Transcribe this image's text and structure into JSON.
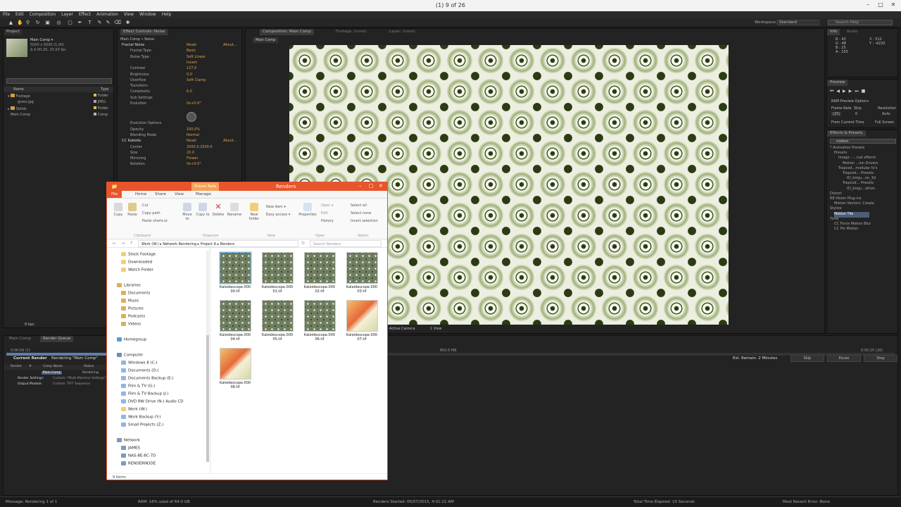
{
  "window": {
    "title": "(1) 9 of 26"
  },
  "menu": [
    "File",
    "Edit",
    "Composition",
    "Layer",
    "Effect",
    "Animation",
    "View",
    "Window",
    "Help"
  ],
  "workspace": {
    "label": "Workspace:",
    "value": "Standard"
  },
  "search_help": "Search Help",
  "project": {
    "tab": "Project",
    "comp_name": "Main Comp ▾",
    "comp_info1": "5000 x 5000 (1.00)",
    "comp_info2": "Δ 0:00:26, 25.00 fps",
    "col_name": "Name",
    "col_type": "Type",
    "items": [
      {
        "name": "Footage",
        "type": "Folder"
      },
      {
        "name": "grass.jpg",
        "type": "JPEG"
      },
      {
        "name": "Solids",
        "type": "Folder"
      },
      {
        "name": "Main Comp",
        "type": "Comp"
      }
    ],
    "bpc": "8 bpc"
  },
  "effect_controls": {
    "tab": "Effect Controls: Noise",
    "header": "Main Comp • Noise",
    "rows": [
      {
        "name": "Fractal Noise",
        "value": "Reset",
        "extra": "About..."
      },
      {
        "name": "Fractal Type",
        "value": "Basic"
      },
      {
        "name": "Noise Type",
        "value": "Soft Linear"
      },
      {
        "name": "",
        "value": "Invert"
      },
      {
        "name": "Contrast",
        "value": "127.0"
      },
      {
        "name": "Brightness",
        "value": "0.0"
      },
      {
        "name": "Overflow",
        "value": "Soft Clamp"
      },
      {
        "name": "Transform",
        "value": ""
      },
      {
        "name": "Complexity",
        "value": "6.0"
      },
      {
        "name": "Sub Settings",
        "value": ""
      },
      {
        "name": "Evolution",
        "value": "0x+0.0°"
      },
      {
        "name": "Evolution Options",
        "value": ""
      },
      {
        "name": "Opacity",
        "value": "100.0%"
      },
      {
        "name": "Blending Mode",
        "value": "Normal"
      },
      {
        "name": "CC Kaleida",
        "value": "Reset",
        "extra": "About..."
      },
      {
        "name": "Center",
        "value": "2500.0,2500.0"
      },
      {
        "name": "Size",
        "value": "20.0"
      },
      {
        "name": "Mirroring",
        "value": "Flower"
      },
      {
        "name": "Rotation",
        "value": "0x+0.0°"
      }
    ]
  },
  "composition": {
    "tabs": [
      "Composition: Main Comp",
      "Footage: (none)",
      "Layer: (none)"
    ],
    "breadcrumb": "Main Comp",
    "zoom": "Active Camera",
    "view": "1 View"
  },
  "info": {
    "tab": "Info",
    "audio_tab": "Audio",
    "r": "R : 42",
    "g": "G : 48",
    "b": "B : 25",
    "a": "A : 255",
    "x": "X : 512",
    "y": "Y : -4220"
  },
  "preview": {
    "tab": "Preview",
    "ram": "RAM Preview Options",
    "frame_rate": "Frame Rate",
    "skip": "Skip",
    "resolution": "Resolution",
    "fps_val": "(25)",
    "skip_val": "0",
    "res_val": "Auto",
    "from_current": "From Current Time",
    "full_screen": "Full Screen"
  },
  "effects_presets": {
    "tab": "Effects & Presets",
    "search": "motion",
    "items": [
      "* Animation Presets",
      "Presets",
      "Image – ...ical effects",
      "Motion ...ion Drivers",
      "Trapcod...modular fx's",
      "Trapcod... Presets",
      "tD_birgu...on_3d",
      "Trapcod... Presets",
      "tD_birgu...athon",
      "Distort",
      "RE:Vision Plug-ins",
      "Motion Vectors: Create",
      "Stylize",
      "Motion Tile",
      "Time",
      "CC Force Motion Blur",
      "CC Pix Motion"
    ]
  },
  "render_queue": {
    "tabs": [
      "Main Comp",
      "Render Queue"
    ],
    "size": "800.6 MB",
    "current_render": "Current Render",
    "rendering": "Rendering \"Main Comp\"",
    "elapsed": "0:00:09 (1)",
    "eta": "0:00:25 (26)",
    "est_remain": "Est. Remain: 2 Minutes",
    "skip": "Skip",
    "pause": "Pause",
    "stop": "Stop",
    "cols": [
      "Render",
      "#",
      "Comp Name",
      "Status"
    ],
    "item_name": "Main Comp",
    "item_status": "Rendering",
    "render_settings": "Render Settings:",
    "render_settings_val": "Custom: \"Multi-Machine Settings\"",
    "output_module": "Output Module:",
    "output_module_val": "Custom: TIFF Sequence"
  },
  "status_bar": {
    "message": "Message:  Rendering 1 of 1",
    "ram": "RAM:  16% used of 64.0 GB",
    "started": "Renders Started:  05/07/2015, 4:01:22 AM",
    "total": "Total Time Elapsed:  10 Seconds",
    "error": "Most Recent Error:  None"
  },
  "explorer": {
    "title": "Renders",
    "picture_tools": "Picture Tools",
    "tabs": [
      "File",
      "Home",
      "Share",
      "View",
      "Manage"
    ],
    "ribbon": {
      "copy": "Copy",
      "paste": "Paste",
      "cut": "Cut",
      "copy_path": "Copy path",
      "paste_shortcut": "Paste shortcut",
      "move_to": "Move to",
      "copy_to": "Copy to",
      "delete": "Delete",
      "rename": "Rename",
      "new_item": "New item ▾",
      "easy_access": "Easy access ▾",
      "new_folder": "New folder",
      "properties": "Properties",
      "open": "Open ▾",
      "edit": "Edit",
      "history": "History",
      "select_all": "Select all",
      "select_none": "Select none",
      "invert_selection": "Invert selection",
      "groups": [
        "Clipboard",
        "Organize",
        "New",
        "Open",
        "Select"
      ]
    },
    "breadcrumb": [
      "Work (W:)",
      "Network Rendering",
      "Project A",
      "Renders"
    ],
    "search_placeholder": "Search Renders",
    "nav": {
      "favorites": [
        "Stock Footage",
        "Downloaded",
        "Watch Folder"
      ],
      "libraries_label": "Libraries",
      "libraries": [
        "Documents",
        "Music",
        "Pictures",
        "Podcasts",
        "Videos"
      ],
      "homegroup": "Homegroup",
      "computer_label": "Computer",
      "drives": [
        "Windows 8 (C:)",
        "Documents (D:)",
        "Documents Backup (E:)",
        "Film & TV (G:)",
        "Film & TV Backup (J:)",
        "DVD RW Drive (N:) Audio CD",
        "Work (W:)",
        "Work Backup (Y:)",
        "Small Projects (Z:)"
      ],
      "network_label": "Network",
      "network": [
        "JAMES",
        "NAS-8E-8C-7D",
        "RENDERNODE"
      ]
    },
    "files": [
      {
        "name": "Kaleidescope.000 00.tif",
        "kind": "pat"
      },
      {
        "name": "Kaleidescope.000 01.tif",
        "kind": "pat"
      },
      {
        "name": "Kaleidescope.000 02.tif",
        "kind": "pat"
      },
      {
        "name": "Kaleidescope.000 03.tif",
        "kind": "pat"
      },
      {
        "name": "Kaleidescope.000 04.tif",
        "kind": "pat"
      },
      {
        "name": "Kaleidescope.000 05.tif",
        "kind": "pat"
      },
      {
        "name": "Kaleidescope.000 06.tif",
        "kind": "pat"
      },
      {
        "name": "Kaleidescope.000 07.tif",
        "kind": "warm"
      },
      {
        "name": "Kaleidescope.000 08.tif",
        "kind": "warm"
      }
    ],
    "item_count": "9 items"
  },
  "colors": {
    "accent": "#e8542b",
    "ae_orange": "#d9a14a",
    "bg": "#1e1e1e"
  }
}
